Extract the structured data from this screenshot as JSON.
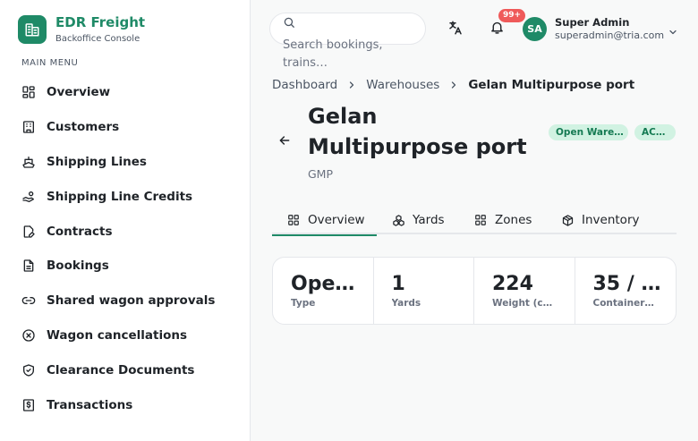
{
  "brand": {
    "name": "EDR Freight",
    "subtitle": "Backoffice Console",
    "logo_icon": "building-icon",
    "accent": "#1f8a67"
  },
  "sidebar": {
    "section_title": "MAIN MENU",
    "items": [
      {
        "label": "Overview",
        "icon": "dashboard-grid-icon"
      },
      {
        "label": "Customers",
        "icon": "building-icon"
      },
      {
        "label": "Shipping Lines",
        "icon": "ship-icon"
      },
      {
        "label": "Shipping Line Credits",
        "icon": "hand-coins-icon"
      },
      {
        "label": "Contracts",
        "icon": "file-pen-icon"
      },
      {
        "label": "Bookings",
        "icon": "file-text-icon"
      },
      {
        "label": "Shared wagon approvals",
        "icon": "link-icon"
      },
      {
        "label": "Wagon cancellations",
        "icon": "circle-x-icon"
      },
      {
        "label": "Clearance Documents",
        "icon": "shield-check-icon"
      },
      {
        "label": "Transactions",
        "icon": "dollar-receipt-icon"
      }
    ]
  },
  "header": {
    "search_placeholder": "Search bookings, trains…",
    "notification_count": "99+",
    "user": {
      "initials": "SA",
      "name": "Super Admin",
      "email": "superadmin@tria.com"
    }
  },
  "breadcrumb": [
    "Dashboard",
    "Warehouses",
    "Gelan Multipurpose port"
  ],
  "page": {
    "title": "Gelan Multipurpose port",
    "code": "GMP",
    "type_badge": "Open Ware…",
    "status_badge": "AC…"
  },
  "tabs": [
    {
      "label": "Overview",
      "icon": "grid-icon",
      "active": true
    },
    {
      "label": "Yards",
      "icon": "boxes-icon",
      "active": false
    },
    {
      "label": "Zones",
      "icon": "grid-icon",
      "active": false
    },
    {
      "label": "Inventory",
      "icon": "package-icon",
      "active": false
    }
  ],
  "stats": [
    {
      "value": "Ope…",
      "label": "Type"
    },
    {
      "value": "1",
      "label": "Yards"
    },
    {
      "value": "224",
      "label": "Weight (c…"
    },
    {
      "value": "35 / …",
      "label": "Container…"
    }
  ]
}
